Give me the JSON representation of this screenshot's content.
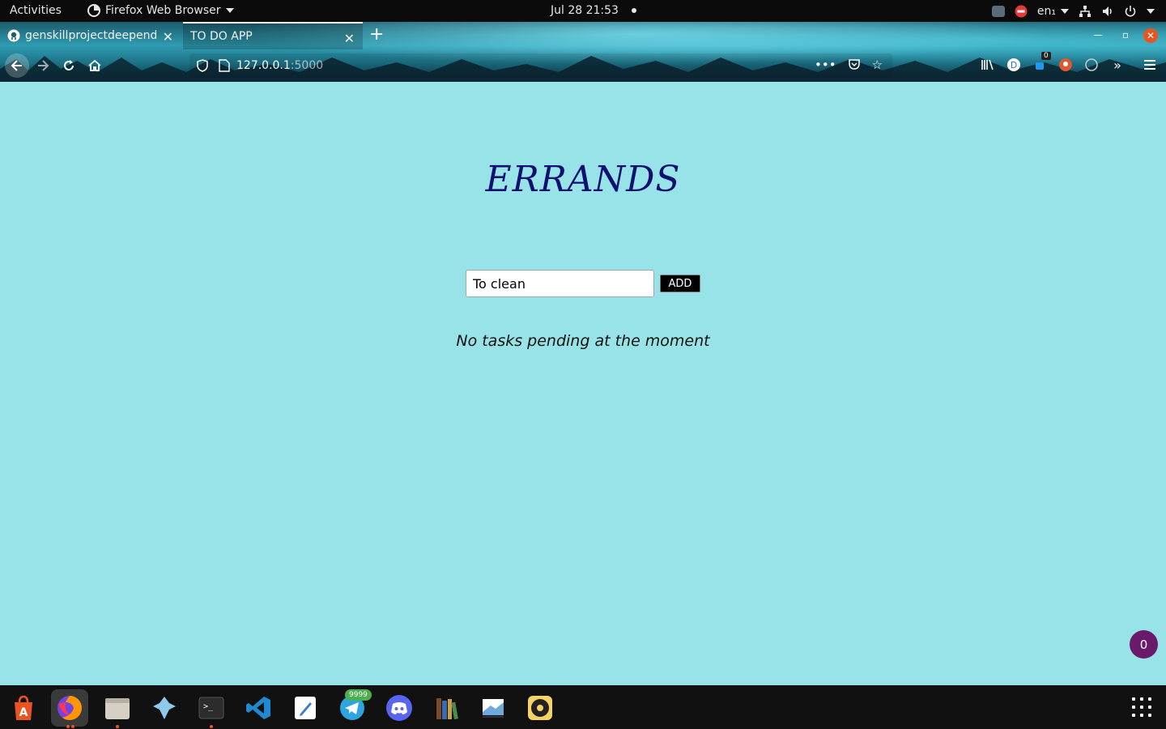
{
  "topbar": {
    "activities": "Activities",
    "app_name": "Firefox Web Browser",
    "datetime": "Jul 28  21:53",
    "language": "en₁"
  },
  "tabs": [
    {
      "title": "genskillprojectdeependu",
      "icon": "github-icon",
      "active": false
    },
    {
      "title": "TO DO APP",
      "icon": "",
      "active": true
    }
  ],
  "navbar": {
    "url_host": "127.0.0.1",
    "url_port": ":5000",
    "extension_badge": "0"
  },
  "page": {
    "background": "#98e3e8",
    "title": "ERRANDS",
    "title_color": "#101070",
    "input_value": "To clean",
    "add_label": "ADD",
    "empty_message": "No tasks pending at the moment",
    "counter": "0"
  },
  "dock": {
    "apps": [
      "ubuntu-software-icon",
      "firefox-icon",
      "files-icon",
      "game-controller-icon",
      "terminal-icon",
      "vscode-icon",
      "text-editor-icon",
      "telegram-icon",
      "discord-icon",
      "calibre-icon",
      "screenshot-tool-icon",
      "rhythmbox-icon"
    ],
    "telegram_badge": "9999"
  }
}
